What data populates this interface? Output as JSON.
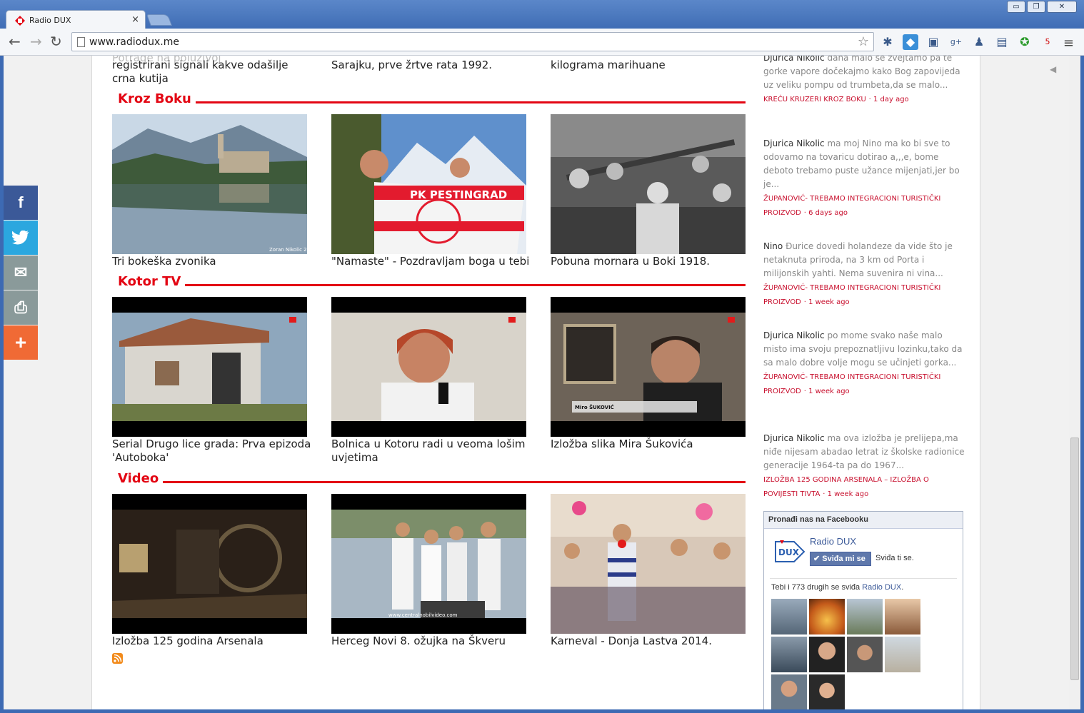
{
  "browser": {
    "tab_title": "Radio DUX",
    "tab_close": "×",
    "url": "www.radiodux.me",
    "window_buttons": [
      "▭",
      "❐",
      "✕"
    ]
  },
  "top_captions": [
    "registrirani signali kakve odašilje crna kutija",
    "Sarajku, prve žrtve rata 1992.",
    "kilograma marihuane"
  ],
  "sections": [
    {
      "title": "Kroz Boku",
      "items": [
        {
          "caption": "Tri bokeška zvonika",
          "watermark": "Zoran Nikolic 20"
        },
        {
          "caption": "\"Namaste\" - Pozdravljam boga u tebi",
          "banner": "PK PESTINGRAD"
        },
        {
          "caption": "Pobuna mornara u Boki 1918."
        }
      ]
    },
    {
      "title": "Kotor TV",
      "items": [
        {
          "caption": "Serial Drugo lice grada: Prva epizoda 'Autoboka'"
        },
        {
          "caption": "Bolnica u Kotoru radi u veoma lošim uvjetima"
        },
        {
          "caption": "Izložba slika Mira Šukovića",
          "lower_third": "Miro ŠUKOVIĆ"
        }
      ]
    },
    {
      "title": "Video",
      "items": [
        {
          "caption": "Izložba 125 godina Arsenala"
        },
        {
          "caption": "Herceg Novi 8. ožujka na Škveru",
          "watermark": "www.centralnobilvideo.com"
        },
        {
          "caption": "Karneval - Donja Lastva 2014."
        }
      ]
    }
  ],
  "comments": [
    {
      "author": "Djurica Nikolic",
      "text": "dana malo se zvejtamo pa te gorke vapore dočekajmo kako Bog zapovijeda uz veliku pompu od trumbeta,da se malo...",
      "post": "KREĆU KRUZERI KROZ BOKU",
      "time": "· 1 day ago"
    },
    {
      "author": "Djurica Nikolic",
      "text": "ma moj Nino ma ko bi sve to odovamo na tovaricu dotirao a,,,e, bome deboto trebamo puste užance mijenjati,jer bo je...",
      "post": "ŽUPANOVIĆ- TREBAMO INTEGRACIONI TURISTIČKI PROIZVOD",
      "time": "· 6 days ago"
    },
    {
      "author": "Nino",
      "text": "Đurice dovedi holandeze da vide što je netaknuta priroda, na 3 km od Porta i milijonskih yahti. Nema suvenira ni vina...",
      "post": "ŽUPANOVIĆ- TREBAMO INTEGRACIONI TURISTIČKI PROIZVOD",
      "time": "· 1 week ago"
    },
    {
      "author": "Djurica Nikolic",
      "text": "po mome svako naše malo misto ima svoju prepoznatljivu lozinku,tako da sa malo dobre volje mogu se učinjeti gorka...",
      "post": "ŽUPANOVIĆ- TREBAMO INTEGRACIONI TURISTIČKI PROIZVOD",
      "time": "· 1 week ago"
    },
    {
      "author": "Djurica Nikolic",
      "text": "ma ova izložba je prelijepa,ma niđe nijesam abadao letrat iz školske radionice generacije 1964-ta pa do 1967...",
      "post": "IZLOŽBA 125 GODINA ARSENALA – IZLOŽBA O POVIJESTI TIVTA",
      "time": "· 1 week ago"
    }
  ],
  "facebook": {
    "header": "Pronađi nas na Facebooku",
    "page_name": "Radio DUX",
    "like_button": "✔ Sviđa mi se",
    "likes_you": "Sviđa ti se.",
    "count_prefix": "Tebi i 773 drugih se sviđa ",
    "count_page": "Radio DUX",
    "count_suffix": ".",
    "faces": 10
  },
  "share_buttons": [
    {
      "name": "facebook",
      "glyph": "f",
      "color": "#3b5998"
    },
    {
      "name": "twitter",
      "glyph": "🐦",
      "color": "#2ba7df"
    },
    {
      "name": "email",
      "glyph": "✉",
      "color": "#8a9a9a"
    },
    {
      "name": "print",
      "glyph": "⎙",
      "color": "#8a9a9a"
    },
    {
      "name": "more",
      "glyph": "+",
      "color": "#f06a35"
    }
  ]
}
